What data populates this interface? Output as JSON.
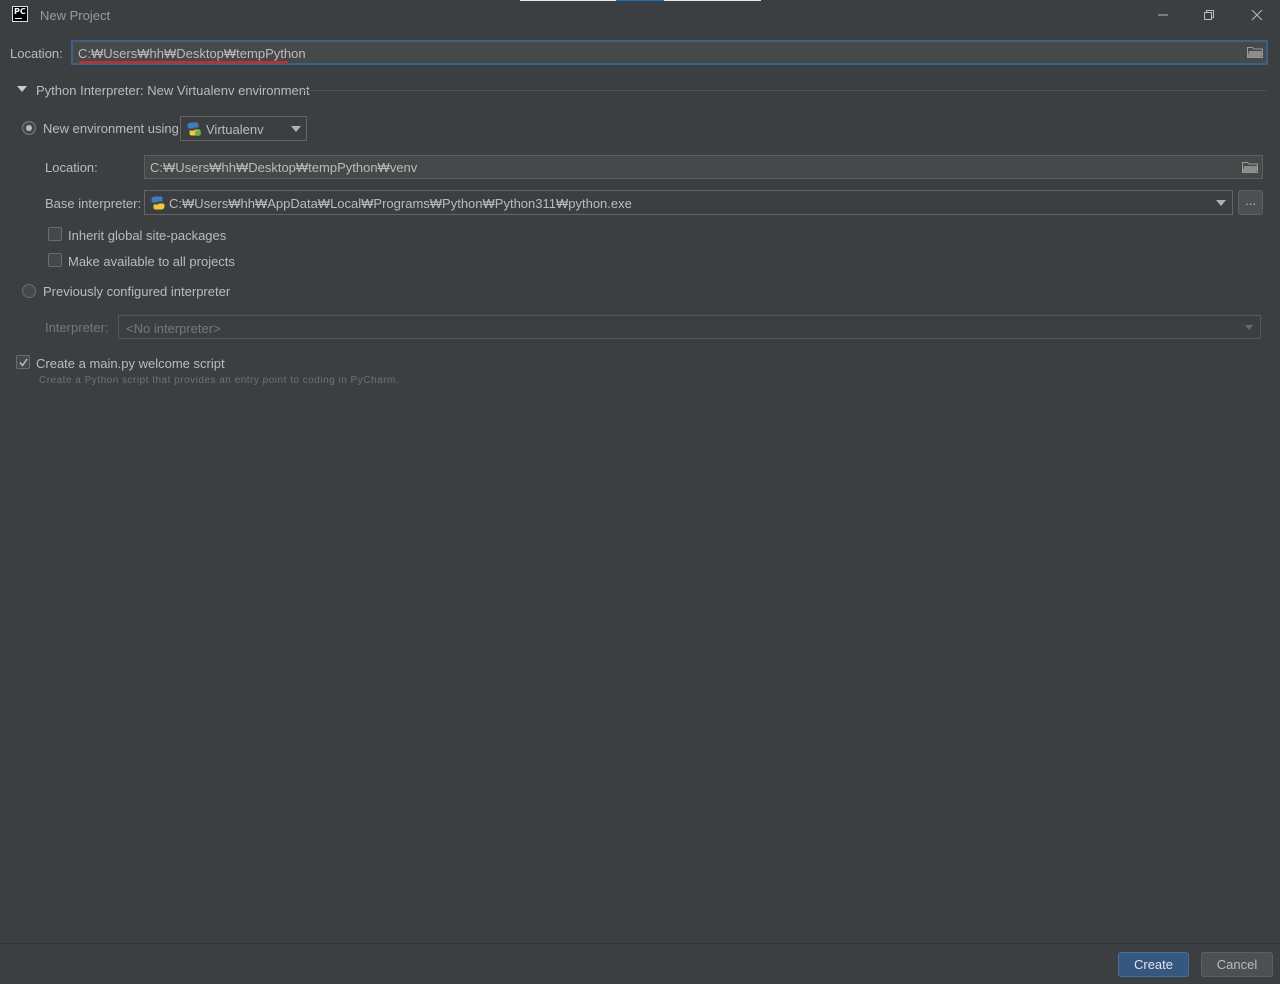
{
  "window": {
    "title": "New Project",
    "app_icon": "pycharm-logo",
    "app_icon_text": "PC",
    "controls": [
      "minimize-icon",
      "restore-icon",
      "close-icon"
    ]
  },
  "project": {
    "location_label": "Location:",
    "location_value": "C:₩Users₩hh₩Desktop₩tempPython"
  },
  "interpreter_section": {
    "title": "Python Interpreter: New Virtualenv environment",
    "new_env": {
      "label": "New environment using",
      "selected": true,
      "tool": "Virtualenv",
      "location_label": "Location:",
      "location_value": "C:₩Users₩hh₩Desktop₩tempPython₩venv",
      "base_label": "Base interpreter:",
      "base_value": "C:₩Users₩hh₩AppData₩Local₩Programs₩Python₩Python311₩python.exe",
      "browse_label": "...",
      "inherit_label": "Inherit global site-packages",
      "inherit_checked": false,
      "available_label": "Make available to all projects",
      "available_checked": false
    },
    "previous": {
      "label": "Previously configured interpreter",
      "selected": false,
      "interpreter_label": "Interpreter:",
      "interpreter_value": "<No interpreter>"
    }
  },
  "welcome": {
    "label": "Create a main.py welcome script",
    "checked": true,
    "hint": "Create a Python script that provides an entry point to coding in PyCharm."
  },
  "footer": {
    "create_label": "Create",
    "cancel_label": "Cancel"
  },
  "colors": {
    "background": "#3c3f41",
    "text": "#bbbbbb",
    "accent": "#365880",
    "focus_border": "#3d6185",
    "annotation_underline": "#e0211f"
  }
}
